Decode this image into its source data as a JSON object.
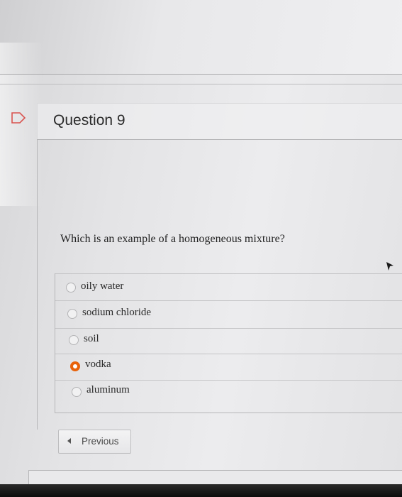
{
  "question": {
    "title": "Question 9",
    "text": "Which is an example of a homogeneous mixture?",
    "options": [
      {
        "label": "oily water",
        "selected": false
      },
      {
        "label": "sodium chloride",
        "selected": false
      },
      {
        "label": "soil",
        "selected": false
      },
      {
        "label": "vodka",
        "selected": true
      },
      {
        "label": "aluminum",
        "selected": false
      }
    ]
  },
  "nav": {
    "previous_label": "Previous"
  },
  "colors": {
    "selected_radio": "#e8620a"
  },
  "icons": {
    "flag": "flag-icon",
    "previous": "chevron-left-icon",
    "cursor": "mouse-pointer-icon"
  }
}
